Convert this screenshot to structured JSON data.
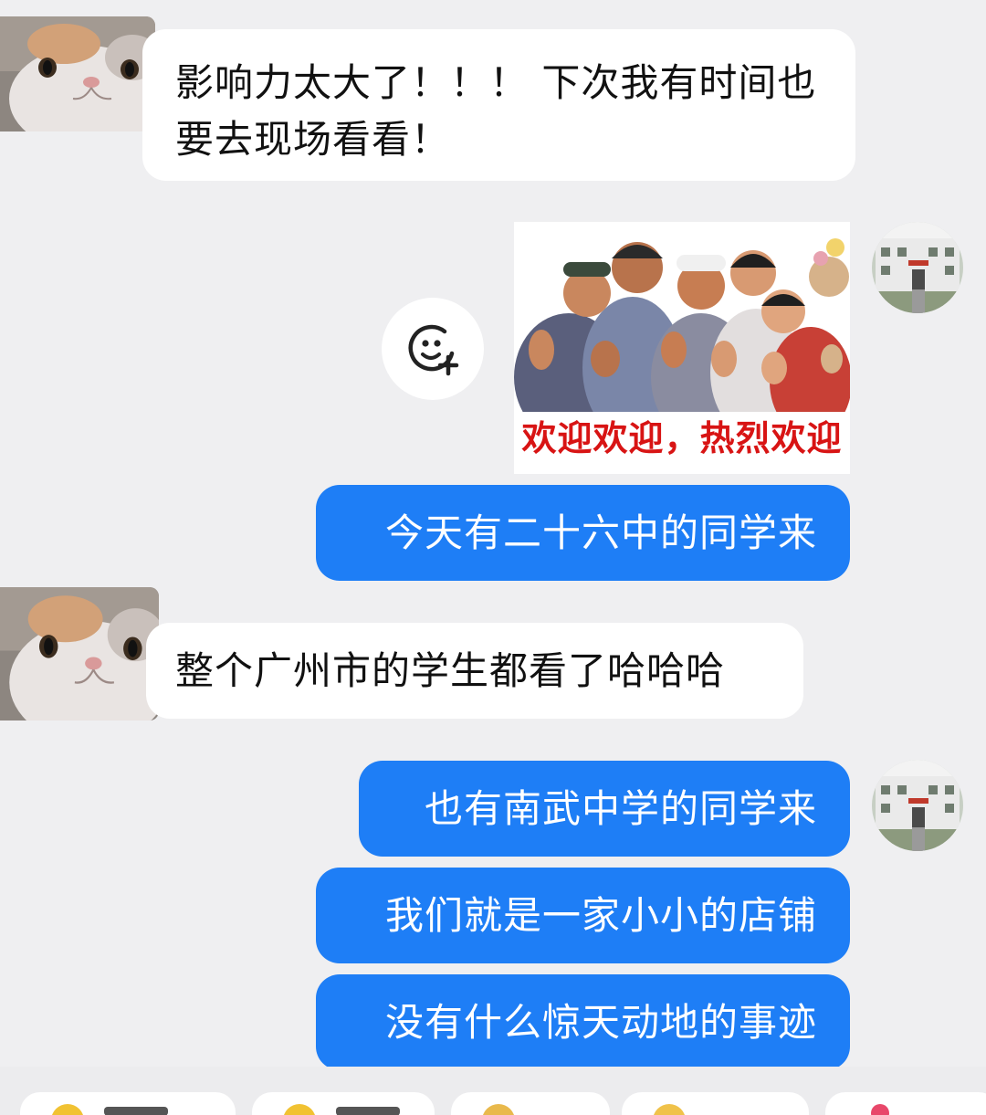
{
  "messages": {
    "m1": {
      "line1": "影响力太大了！！！ 下次我有时间也",
      "line2": "要去现场看看！"
    },
    "sticker": {
      "caption": "欢迎欢迎，热烈欢迎"
    },
    "m3": "今天有二十六中的同学来",
    "m4": "整个广州市的学生都看了哈哈哈",
    "m5": "也有南武中学的同学来",
    "m6": "我们就是一家小小的店铺",
    "m7": "没有什么惊天动地的事迹"
  },
  "colors": {
    "background": "#efeff1",
    "incoming_bubble": "#ffffff",
    "outgoing_bubble": "#1e7ef6",
    "sticker_caption": "#d81414"
  },
  "icons": {
    "add_sticker": "smiley-plus-icon"
  }
}
